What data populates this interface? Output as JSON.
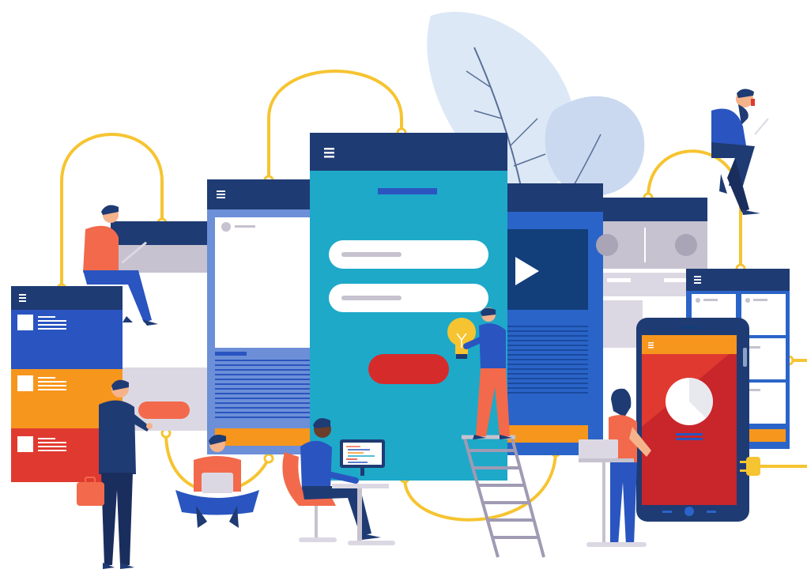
{
  "colors": {
    "navy": "#1f3b73",
    "blue": "#2a64c8",
    "sky": "#1ea9c9",
    "orange": "#f7961d",
    "red": "#e03a30",
    "yellow": "#f6c431",
    "lightblue": "#dfeaf6",
    "gray": "#c6c2cf",
    "skin": "#f5b38c",
    "white": "#ffffff"
  },
  "icons": {
    "menu": "hamburger-menu-icon",
    "play": "play-icon",
    "bulb": "lightbulb-icon",
    "plug": "power-plug-icon",
    "avatar": "avatar-circle-icon"
  }
}
